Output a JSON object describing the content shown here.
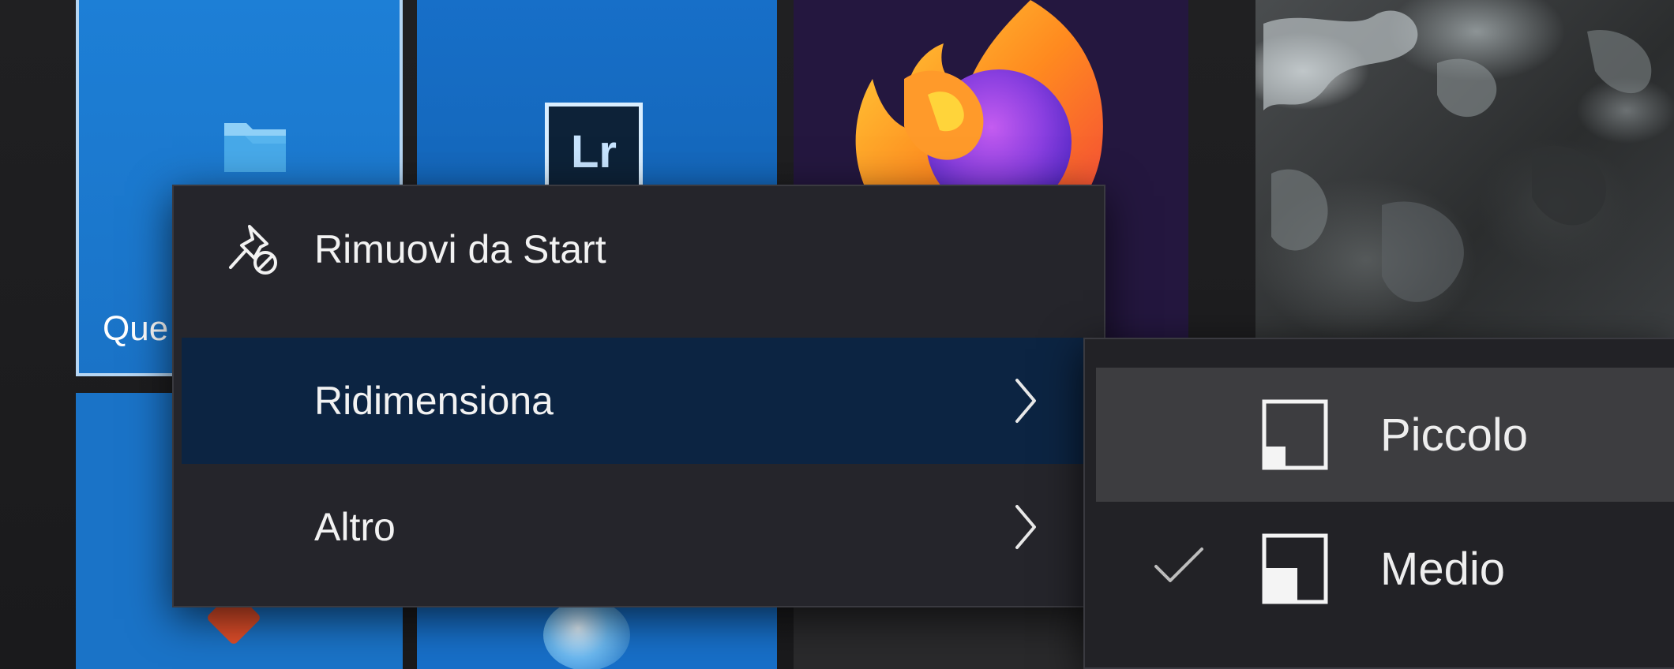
{
  "tiles": {
    "explorer": {
      "label": "Que",
      "icon": "folder-icon"
    },
    "lightroom": {
      "icon_text": "Lr"
    },
    "firefox": {
      "icon": "firefox-icon"
    }
  },
  "context_menu": {
    "items": [
      {
        "label": "Rimuovi da Start",
        "icon": "unpin-icon"
      },
      {
        "label": "Ridimensiona",
        "icon": "chevron-right-icon"
      },
      {
        "label": "Altro",
        "icon": "chevron-right-icon"
      }
    ]
  },
  "submenu": {
    "items": [
      {
        "label": "Piccolo",
        "icon": "small-tile-icon",
        "checked": false
      },
      {
        "label": "Medio",
        "icon": "medium-tile-icon",
        "checked": true
      }
    ]
  },
  "colors": {
    "tile_blue": "#1a73c7",
    "menu_bg": "#25252b",
    "menu_highlight": "#0c2442",
    "submenu_hover": "#3d3d40"
  }
}
